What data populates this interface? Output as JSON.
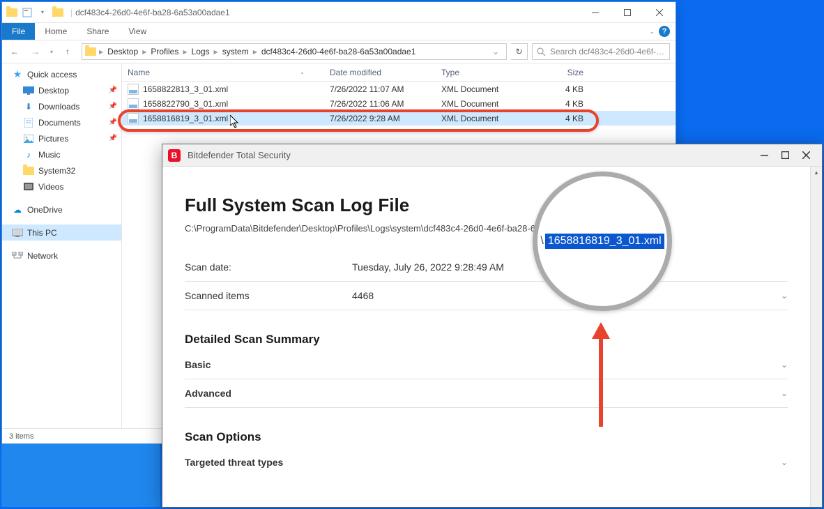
{
  "explorer": {
    "title": "dcf483c4-26d0-4e6f-ba28-6a53a00adae1",
    "tabs": {
      "file": "File",
      "home": "Home",
      "share": "Share",
      "view": "View"
    },
    "breadcrumb": [
      "Desktop",
      "Profiles",
      "Logs",
      "system",
      "dcf483c4-26d0-4e6f-ba28-6a53a00adae1"
    ],
    "search_placeholder": "Search dcf483c4-26d0-4e6f-…",
    "columns": {
      "name": "Name",
      "date": "Date modified",
      "type": "Type",
      "size": "Size"
    },
    "rows": [
      {
        "name": "1658822813_3_01.xml",
        "date": "7/26/2022 11:07 AM",
        "type": "XML Document",
        "size": "4 KB"
      },
      {
        "name": "1658822790_3_01.xml",
        "date": "7/26/2022 11:06 AM",
        "type": "XML Document",
        "size": "4 KB"
      },
      {
        "name": "1658816819_3_01.xml",
        "date": "7/26/2022 9:28 AM",
        "type": "XML Document",
        "size": "4 KB"
      }
    ],
    "nav": {
      "quick": "Quick access",
      "items": [
        "Desktop",
        "Downloads",
        "Documents",
        "Pictures",
        "Music",
        "System32",
        "Videos"
      ],
      "onedrive": "OneDrive",
      "thispc": "This PC",
      "network": "Network"
    },
    "status": "3 items"
  },
  "bd": {
    "title": "Bitdefender Total Security",
    "h1": "Full System Scan Log File",
    "path_prefix": "C:\\ProgramData\\Bitdefender\\Desktop\\Profiles\\Logs\\system\\dcf483c4-26d0-4e6f-ba28-6a53a",
    "path_slash": "\\",
    "path_file": "1658816819_3_01.xml",
    "rows": {
      "scan_date_label": "Scan date:",
      "scan_date_value": "Tuesday, July 26, 2022 9:28:49 AM",
      "scanned_items_label": "Scanned items",
      "scanned_items_value": "4468"
    },
    "summary_h": "Detailed Scan Summary",
    "basic": "Basic",
    "advanced": "Advanced",
    "options_h": "Scan Options",
    "targeted": "Targeted threat types"
  },
  "mag": {
    "file": "1658816819_3_01.xml"
  }
}
